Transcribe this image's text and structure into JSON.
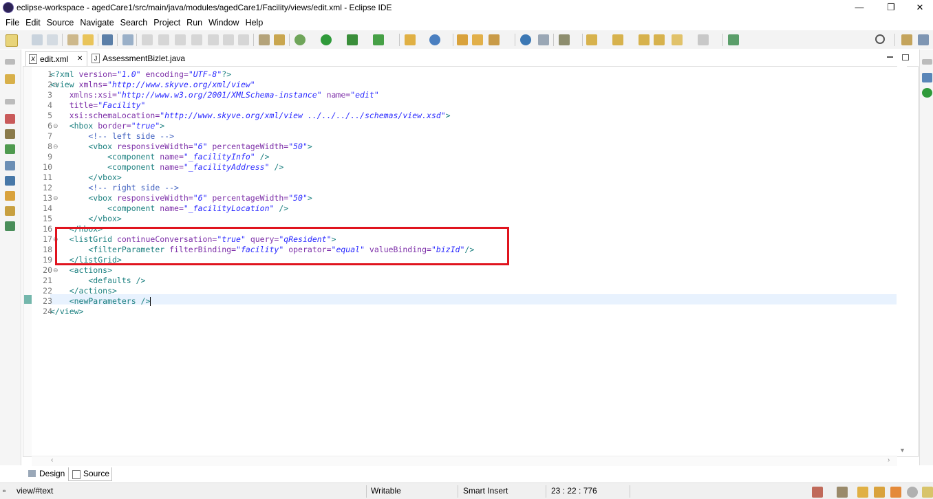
{
  "window": {
    "title": "eclipse-workspace - agedCare1/src/main/java/modules/agedCare1/Facility/views/edit.xml - Eclipse IDE",
    "minimize": "—",
    "restore": "❐",
    "close": "✕"
  },
  "menu": [
    "File",
    "Edit",
    "Source",
    "Navigate",
    "Search",
    "Project",
    "Run",
    "Window",
    "Help"
  ],
  "tabs": [
    {
      "label": "edit.xml",
      "icon": "xml-file-icon",
      "active": true,
      "close": "✕"
    },
    {
      "label": "AssessmentBizlet.java",
      "icon": "java-file-icon",
      "active": false
    }
  ],
  "editor": {
    "line_numbers": [
      "1",
      "2",
      "3",
      "4",
      "5",
      "6",
      "7",
      "8",
      "9",
      "10",
      "11",
      "12",
      "13",
      "14",
      "15",
      "16",
      "17",
      "18",
      "19",
      "20",
      "21",
      "22",
      "23",
      "24"
    ],
    "code_lines": [
      [
        {
          "t": "tg",
          "v": "<?xml "
        },
        {
          "t": "at",
          "v": "version="
        },
        {
          "t": "st",
          "v": "\"1.0\""
        },
        {
          "t": "at",
          "v": " encoding="
        },
        {
          "t": "st",
          "v": "\"UTF-8\""
        },
        {
          "t": "tg",
          "v": "?>"
        }
      ],
      [
        {
          "t": "tg",
          "v": "<view "
        },
        {
          "t": "at",
          "v": "xmlns="
        },
        {
          "t": "st",
          "v": "\"http://www.skyve.org/xml/view\""
        }
      ],
      [
        {
          "t": "at",
          "v": "    xmlns:xsi="
        },
        {
          "t": "st",
          "v": "\"http://www.w3.org/2001/XMLSchema-instance\""
        },
        {
          "t": "at",
          "v": " name="
        },
        {
          "t": "st",
          "v": "\"edit\""
        }
      ],
      [
        {
          "t": "at",
          "v": "    title="
        },
        {
          "t": "st",
          "v": "\"Facility\""
        }
      ],
      [
        {
          "t": "at",
          "v": "    xsi:schemaLocation="
        },
        {
          "t": "st",
          "v": "\"http://www.skyve.org/xml/view ../../../../schemas/view.xsd\""
        },
        {
          "t": "tg",
          "v": ">"
        }
      ],
      [
        {
          "t": "tg",
          "v": "    <hbox "
        },
        {
          "t": "at",
          "v": "border="
        },
        {
          "t": "st",
          "v": "\"true\""
        },
        {
          "t": "tg",
          "v": ">"
        }
      ],
      [
        {
          "t": "cm",
          "v": "        <!-- left side -->"
        }
      ],
      [
        {
          "t": "tg",
          "v": "        <vbox "
        },
        {
          "t": "at",
          "v": "responsiveWidth="
        },
        {
          "t": "st",
          "v": "\"6\""
        },
        {
          "t": "at",
          "v": " percentageWidth="
        },
        {
          "t": "st",
          "v": "\"50\""
        },
        {
          "t": "tg",
          "v": ">"
        }
      ],
      [
        {
          "t": "tg",
          "v": "            <component "
        },
        {
          "t": "at",
          "v": "name="
        },
        {
          "t": "st",
          "v": "\"_facilityInfo\""
        },
        {
          "t": "tg",
          "v": " />"
        }
      ],
      [
        {
          "t": "tg",
          "v": "            <component "
        },
        {
          "t": "at",
          "v": "name="
        },
        {
          "t": "st",
          "v": "\"_facilityAddress\""
        },
        {
          "t": "tg",
          "v": " />"
        }
      ],
      [
        {
          "t": "tg",
          "v": "        </vbox>"
        }
      ],
      [
        {
          "t": "cm",
          "v": "        <!-- right side -->"
        }
      ],
      [
        {
          "t": "tg",
          "v": "        <vbox "
        },
        {
          "t": "at",
          "v": "responsiveWidth="
        },
        {
          "t": "st",
          "v": "\"6\""
        },
        {
          "t": "at",
          "v": " percentageWidth="
        },
        {
          "t": "st",
          "v": "\"50\""
        },
        {
          "t": "tg",
          "v": ">"
        }
      ],
      [
        {
          "t": "tg",
          "v": "            <component "
        },
        {
          "t": "at",
          "v": "name="
        },
        {
          "t": "st",
          "v": "\"_facilityLocation\""
        },
        {
          "t": "tg",
          "v": " />"
        }
      ],
      [
        {
          "t": "tg",
          "v": "        </vbox>"
        }
      ],
      [
        {
          "t": "tg",
          "v": "    </hbox>"
        }
      ],
      [
        {
          "t": "tg",
          "v": "    <listGrid "
        },
        {
          "t": "at",
          "v": "continueConversation="
        },
        {
          "t": "st",
          "v": "\"true\""
        },
        {
          "t": "at",
          "v": " query="
        },
        {
          "t": "st",
          "v": "\"qResident\""
        },
        {
          "t": "tg",
          "v": ">"
        }
      ],
      [
        {
          "t": "tg",
          "v": "        <filterParameter "
        },
        {
          "t": "at",
          "v": "filterBinding="
        },
        {
          "t": "st",
          "v": "\"facility\""
        },
        {
          "t": "at",
          "v": " operator="
        },
        {
          "t": "st",
          "v": "\"equal\""
        },
        {
          "t": "at",
          "v": " valueBinding="
        },
        {
          "t": "st",
          "v": "\"bizId\""
        },
        {
          "t": "tg",
          "v": "/>"
        }
      ],
      [
        {
          "t": "tg",
          "v": "    </listGrid>"
        }
      ],
      [
        {
          "t": "tg",
          "v": "    <actions>"
        }
      ],
      [
        {
          "t": "tg",
          "v": "        <defaults />"
        }
      ],
      [
        {
          "t": "tg",
          "v": "    </actions>"
        }
      ],
      [
        {
          "t": "tg",
          "v": "    <newParameters />"
        }
      ],
      [
        {
          "t": "tg",
          "v": "</view>"
        }
      ]
    ],
    "current_line": 23
  },
  "bottom_tabs": [
    {
      "label": "Design",
      "icon": "design-icon"
    },
    {
      "label": "Source",
      "icon": "source-icon",
      "active": true
    }
  ],
  "status": {
    "path": "view/#text",
    "writable": "Writable",
    "insert_mode": "Smart Insert",
    "position": "23 : 22 : 776"
  }
}
